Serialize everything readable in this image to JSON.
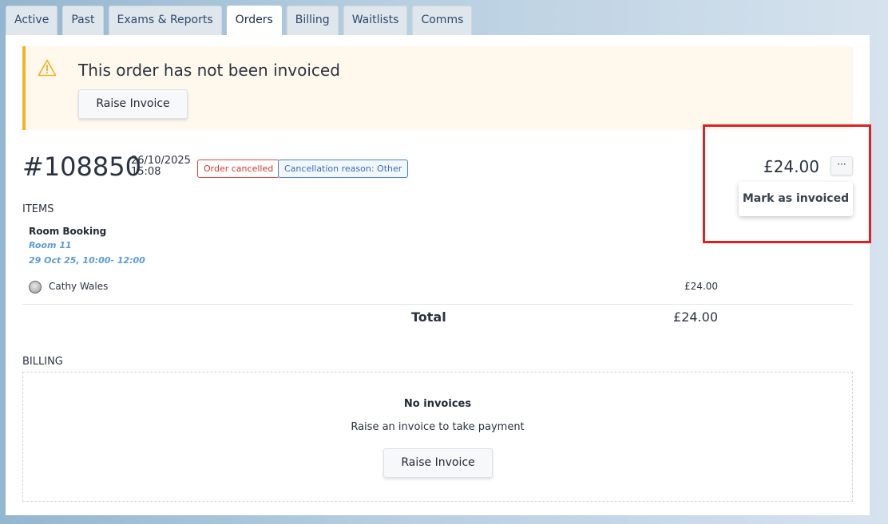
{
  "tabs": [
    {
      "label": "Active"
    },
    {
      "label": "Past"
    },
    {
      "label": "Exams & Reports"
    },
    {
      "label": "Orders"
    },
    {
      "label": "Billing"
    },
    {
      "label": "Waitlists"
    },
    {
      "label": "Comms"
    }
  ],
  "active_tab": "Orders",
  "alert": {
    "icon": "warning-icon",
    "title": "This order has not been invoiced",
    "button_label": "Raise Invoice",
    "accent_color": "#f5b324",
    "background_color": "#fef8ed"
  },
  "order": {
    "number": "#108850",
    "date": "26/10/2025",
    "time": "15:08",
    "status_badge": "Order cancelled",
    "reason_badge": "Cancellation reason: Other",
    "total": "£24.00",
    "more_button_label": "···",
    "menu_item_label": "Mark as invoiced"
  },
  "items": {
    "section_label": "ITEMS",
    "title": "Room Booking",
    "room": "Room 11",
    "slot": "29 Oct 25, 10:00- 12:00",
    "person": "Cathy Wales",
    "price": "£24.00",
    "total_label": "Total",
    "total_value": "£24.00"
  },
  "billing": {
    "section_label": "BILLING",
    "empty_title": "No invoices",
    "empty_text": "Raise an invoice to take payment",
    "button_label": "Raise Invoice"
  },
  "colors": {
    "cancelled": "#d6352d",
    "reason": "#3a6eb8",
    "highlight": "#e02020",
    "link": "#5b9bd5"
  }
}
